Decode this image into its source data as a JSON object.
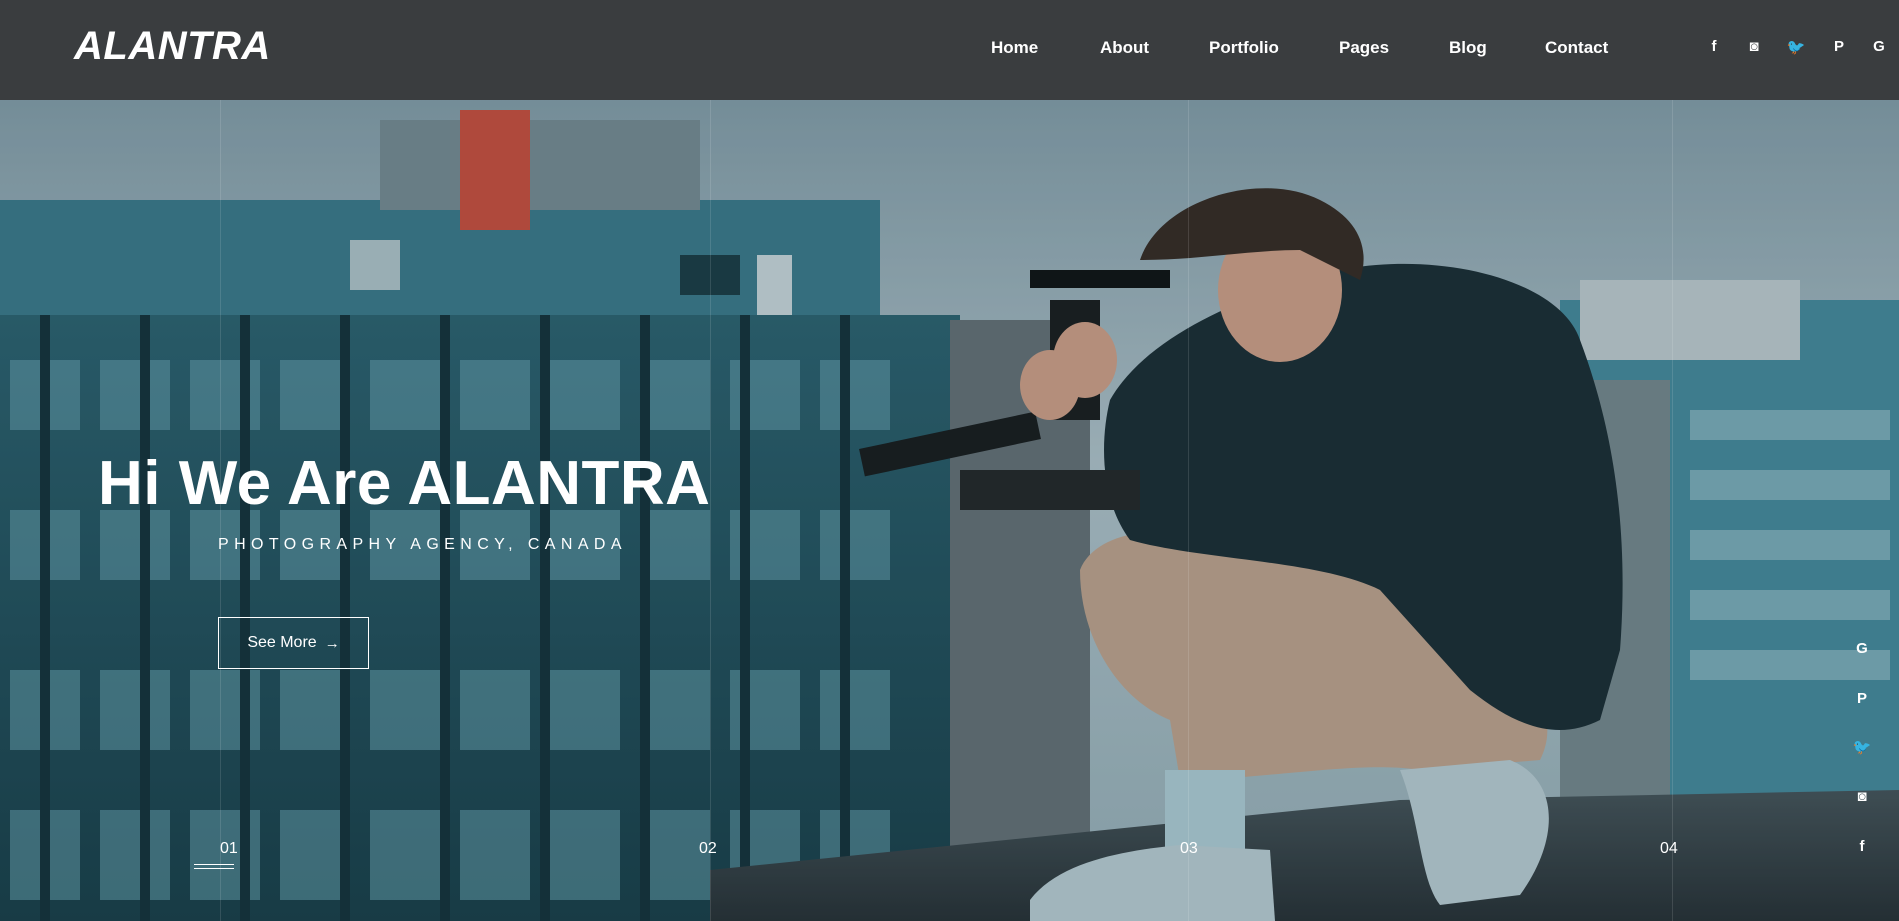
{
  "brand": {
    "logo": "ALANTRA"
  },
  "nav": {
    "items": [
      {
        "label": "Home"
      },
      {
        "label": "About"
      },
      {
        "label": "Portfolio"
      },
      {
        "label": "Pages"
      },
      {
        "label": "Blog"
      },
      {
        "label": "Contact"
      }
    ]
  },
  "social_top": {
    "icons": [
      {
        "icon": "facebook-icon",
        "glyph": "f"
      },
      {
        "icon": "instagram-icon",
        "glyph": "◙"
      },
      {
        "icon": "twitter-icon",
        "glyph": "🐦"
      },
      {
        "icon": "pinterest-icon",
        "glyph": "P"
      },
      {
        "icon": "google-icon",
        "glyph": "G"
      }
    ]
  },
  "hero": {
    "title": "Hi We Are ALANTRA",
    "subtitle": "PHOTOGRAPHY AGENCY, CANADA",
    "cta_label": "See More",
    "cta_arrow": "→"
  },
  "slides": {
    "items": [
      {
        "label": "01"
      },
      {
        "label": "02"
      },
      {
        "label": "03"
      },
      {
        "label": "04"
      }
    ],
    "active": "01"
  },
  "social_side": {
    "icons": [
      {
        "icon": "google-icon",
        "glyph": "G"
      },
      {
        "icon": "pinterest-icon",
        "glyph": "P"
      },
      {
        "icon": "twitter-icon",
        "glyph": "🐦"
      },
      {
        "icon": "instagram-icon",
        "glyph": "◙"
      },
      {
        "icon": "facebook-icon",
        "glyph": "f"
      }
    ]
  },
  "colors": {
    "header_bg": "#3a3d3f",
    "text": "#ffffff",
    "sky": "#aebfc8",
    "building": "#2d5e6b",
    "jacket": "#1d2c33",
    "pants": "#c9a890"
  }
}
